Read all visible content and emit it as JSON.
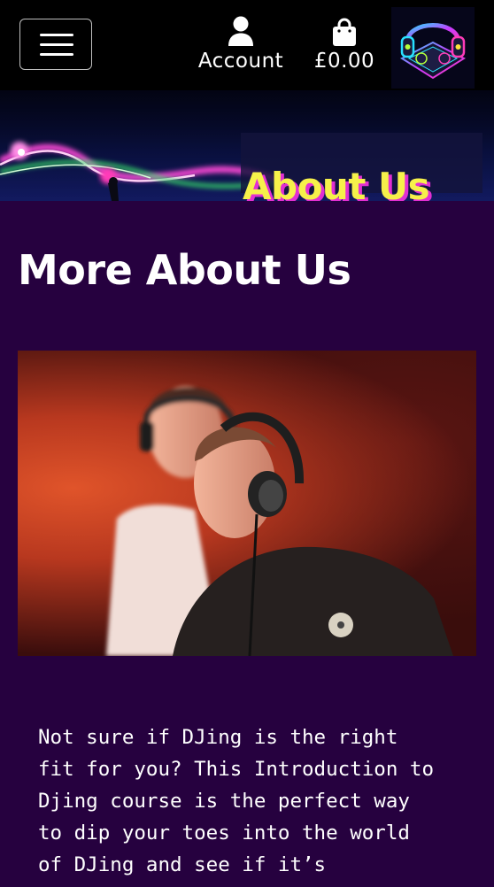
{
  "header": {
    "account_label": "Account",
    "bag_total": "£0.00"
  },
  "banner": {
    "title": "About Us"
  },
  "main": {
    "heading": "More About Us",
    "intro": "Not sure if DJing is the right fit for you? This Introduction to Djing course is the perfect way to dip your toes into the world of DJing and see if it’s"
  },
  "colors": {
    "header_bg": "#000000",
    "page_bg": "#26013f",
    "banner_title": "#f6f14a",
    "banner_title_shadow": "#e12fd2"
  },
  "icons": {
    "menu": "hamburger-icon",
    "account": "user-icon",
    "bag": "shopping-bag-icon"
  }
}
